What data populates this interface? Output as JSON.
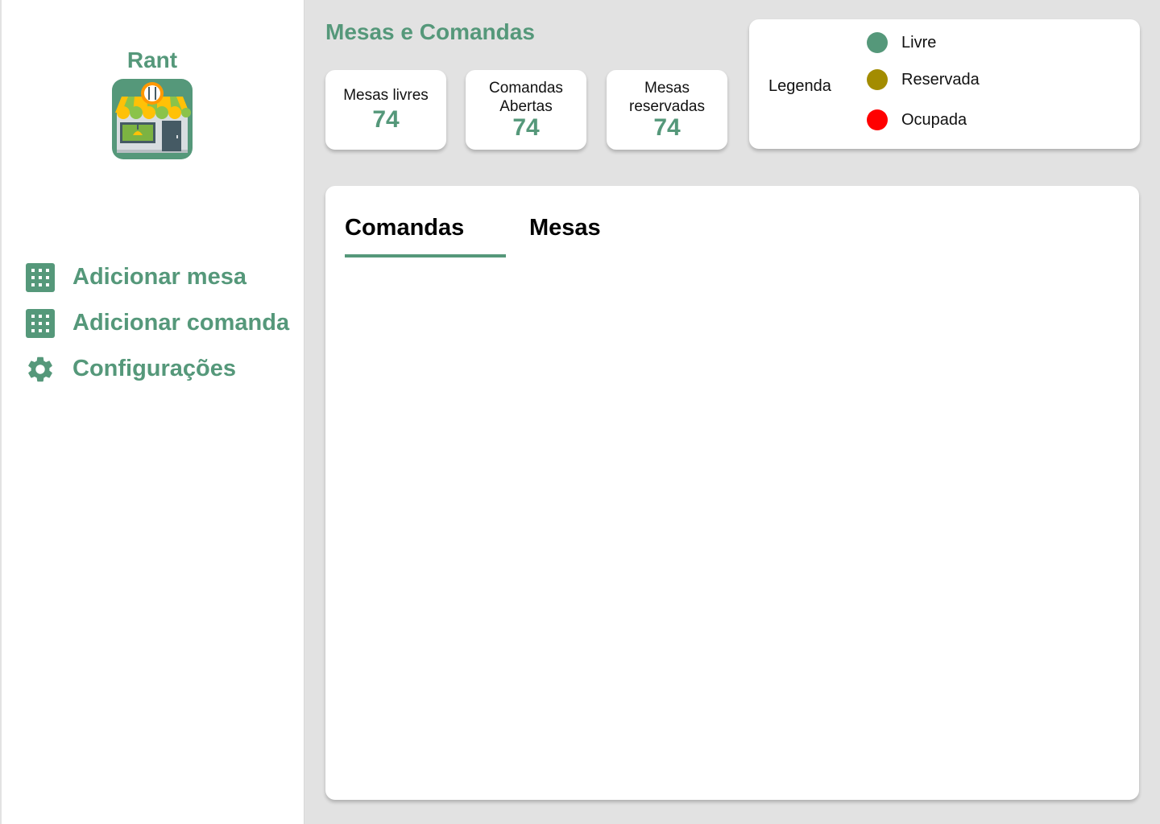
{
  "sidebar": {
    "brand": "Rant",
    "logo_icon": "restaurant-storefront-icon",
    "items": [
      {
        "label": "Adicionar mesa",
        "icon": "grid-icon"
      },
      {
        "label": "Adicionar comanda",
        "icon": "grid-icon"
      },
      {
        "label": "Configurações",
        "icon": "gear-icon"
      }
    ]
  },
  "header": {
    "title": "Mesas e Comandas"
  },
  "stats": [
    {
      "label": "Mesas livres",
      "value": "74"
    },
    {
      "label": "Comandas Abertas",
      "value": "74"
    },
    {
      "label": "Mesas reservadas",
      "value": "74"
    }
  ],
  "legend": {
    "title": "Legenda",
    "items": [
      {
        "label": "Livre",
        "color": "#55987a"
      },
      {
        "label": "Reservada",
        "color": "#a38c00"
      },
      {
        "label": "Ocupada",
        "color": "#ff0000"
      }
    ]
  },
  "tabs": [
    {
      "label": "Comandas",
      "active": true
    },
    {
      "label": "Mesas",
      "active": false
    }
  ],
  "colors": {
    "accent": "#55987a",
    "background": "#e2e2e2"
  }
}
